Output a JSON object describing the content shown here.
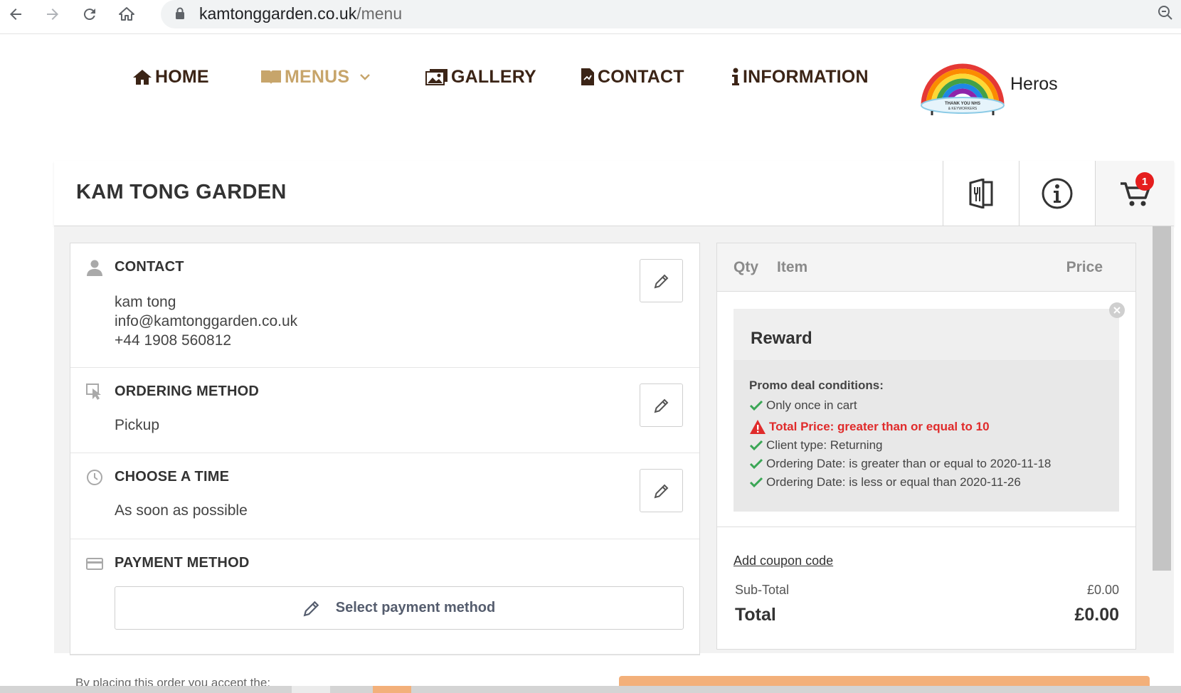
{
  "browser": {
    "url_domain": "kamtonggarden.co.uk",
    "url_path": "/menu",
    "icons": [
      "back-arrow-icon",
      "forward-arrow-icon",
      "reload-icon",
      "home-icon",
      "lock-icon",
      "zoom-icon"
    ]
  },
  "nav": {
    "items": [
      {
        "label": "HOME",
        "icon": "house-icon"
      },
      {
        "label": "MENUS",
        "icon": "book-icon",
        "active": true
      },
      {
        "label": "GALLERY",
        "icon": "images-icon"
      },
      {
        "label": "CONTACT",
        "icon": "document-icon"
      },
      {
        "label": "INFORMATION",
        "icon": "info-icon"
      }
    ],
    "heros_label": "Heros",
    "logo_text": "THANK YOU NHS & KEYWORKERS"
  },
  "shop": {
    "title": "KAM TONG GARDEN",
    "cart_count": "1",
    "header_icons": [
      "menu-book-icon",
      "info-circle-icon",
      "cart-icon"
    ]
  },
  "checkout": {
    "contact": {
      "title": "CONTACT",
      "name": "kam tong",
      "email": "info@kamtonggarden.co.uk",
      "phone": "+44 1908 560812"
    },
    "ordering": {
      "title": "ORDERING METHOD",
      "value": "Pickup"
    },
    "time": {
      "title": "CHOOSE A TIME",
      "value": "As soon as possible"
    },
    "payment": {
      "title": "PAYMENT METHOD",
      "button_label": "Select payment method"
    }
  },
  "cart": {
    "col_qty": "Qty",
    "col_item": "Item",
    "col_price": "Price",
    "reward": {
      "title": "Reward",
      "conditions_title": "Promo deal conditions:",
      "conditions": [
        {
          "text": "Only once in cart",
          "status": "ok"
        },
        {
          "text": "Total Price: greater than or equal to 10",
          "status": "warning"
        },
        {
          "text": "Client type: Returning",
          "status": "ok"
        },
        {
          "text": "Ordering Date: is greater than or equal to 2020-11-18",
          "status": "ok"
        },
        {
          "text": "Ordering Date: is less or equal than 2020-11-26",
          "status": "ok"
        }
      ]
    },
    "coupon_label": "Add coupon code",
    "subtotal_label": "Sub-Total",
    "subtotal_value": "£0.00",
    "total_label": "Total",
    "total_value": "£0.00"
  },
  "footer": {
    "note": "By placing this order you accept the:"
  },
  "colors": {
    "nav_text": "#3b2416",
    "nav_active": "#c7a56b",
    "check": "#3aa655",
    "warning": "#e02b2b",
    "badge": "#e51e1e",
    "place_order": "#f3b07a"
  }
}
